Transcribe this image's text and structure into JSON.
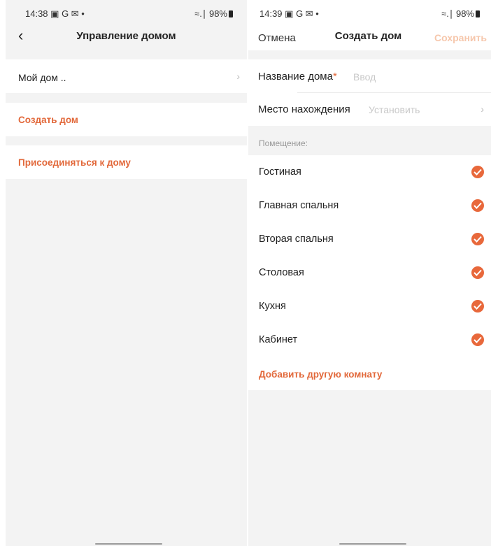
{
  "left": {
    "status": {
      "time": "14:38",
      "icons": "▣ G ✉ •",
      "signal": "≈.∣ 98%"
    },
    "title": "Управление домом",
    "home_item": "Мой дом ..",
    "create_home": "Создать дом",
    "join_home": "Присоединяться к дому"
  },
  "right": {
    "status": {
      "time": "14:39",
      "icons": "▣ G ✉ •",
      "signal": "≈.∣ 98%"
    },
    "cancel": "Отмена",
    "title": "Создать дом",
    "save": "Сохранить",
    "name_label": "Название дома",
    "required_mark": "*",
    "name_placeholder": "Ввод",
    "location_label": "Место нахождения",
    "location_placeholder": "Установить",
    "rooms_caption": "Помещение:",
    "rooms": [
      "Гостиная",
      "Главная спальня",
      "Вторая спальня",
      "Столовая",
      "Кухня",
      "Кабинет"
    ],
    "add_room": "Добавить другую комнату"
  },
  "colors": {
    "accent": "#e2683a",
    "check": "#e8683b",
    "save_disabled": "#f6c7ac"
  }
}
